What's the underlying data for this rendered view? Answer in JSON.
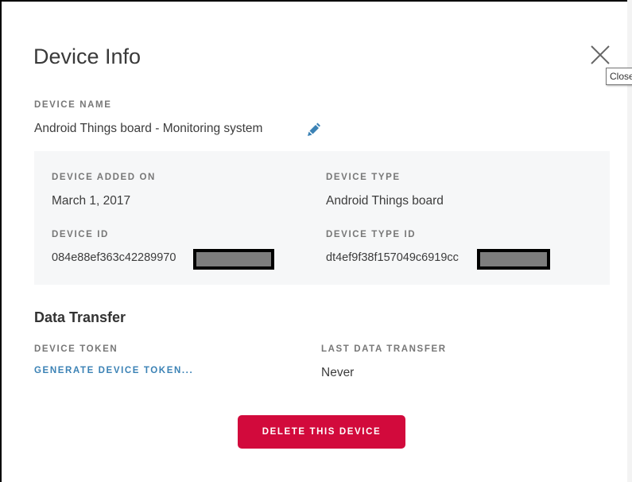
{
  "dialog": {
    "title": "Device Info",
    "close_tooltip": "Close",
    "close_icon": "close-x-icon"
  },
  "device_name": {
    "label": "DEVICE NAME",
    "value": "Android Things board - Monitoring system",
    "edit_icon": "pencil-icon"
  },
  "details": {
    "added_on_label": "DEVICE ADDED ON",
    "added_on_value": "March 1, 2017",
    "type_label": "DEVICE TYPE",
    "type_value": "Android Things board",
    "id_label": "DEVICE ID",
    "id_value": "084e88ef363c42289970",
    "type_id_label": "DEVICE TYPE ID",
    "type_id_value": "dt4ef9f38f157049c6919cc"
  },
  "data_transfer": {
    "title": "Data Transfer",
    "token_label": "DEVICE TOKEN",
    "token_link": "GENERATE DEVICE TOKEN...",
    "last_transfer_label": "LAST DATA TRANSFER",
    "last_transfer_value": "Never"
  },
  "actions": {
    "delete_label": "DELETE THIS DEVICE"
  },
  "colors": {
    "accent_blue": "#3b82b5",
    "delete_red": "#d20a3c",
    "panel_bg": "#f6f7f8"
  }
}
